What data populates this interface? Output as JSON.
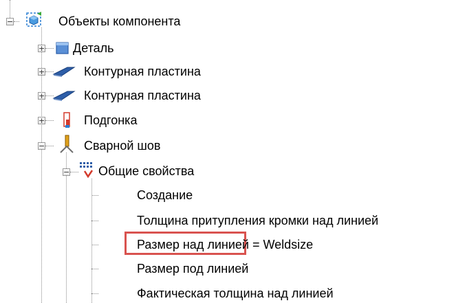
{
  "tree": {
    "root": {
      "label": "Объекты компонента",
      "icon": "component-objects-icon",
      "expanded": true
    },
    "children": [
      {
        "label": "Деталь",
        "icon": "part-icon",
        "expanded": false
      },
      {
        "label": "Контурная пластина",
        "icon": "contour-plate-icon",
        "expanded": false
      },
      {
        "label": "Контурная пластина",
        "icon": "contour-plate-icon",
        "expanded": false
      },
      {
        "label": "Подгонка",
        "icon": "fitting-icon",
        "expanded": false
      },
      {
        "label": "Сварной шов",
        "icon": "weld-icon",
        "expanded": true
      }
    ],
    "group": {
      "label": "Общие свойства",
      "icon": "general-properties-icon",
      "expanded": true
    },
    "properties": [
      {
        "label": "Создание"
      },
      {
        "label": "Толщина притупления кромки над линией"
      },
      {
        "label": "Размер над линией = Weldsize",
        "highlighted": true
      },
      {
        "label": "Размер под линией"
      },
      {
        "label": "Фактическая толщина над линией"
      }
    ]
  },
  "colors": {
    "highlight_border": "#d9534f",
    "tree_guides": "#8a8a8a"
  }
}
